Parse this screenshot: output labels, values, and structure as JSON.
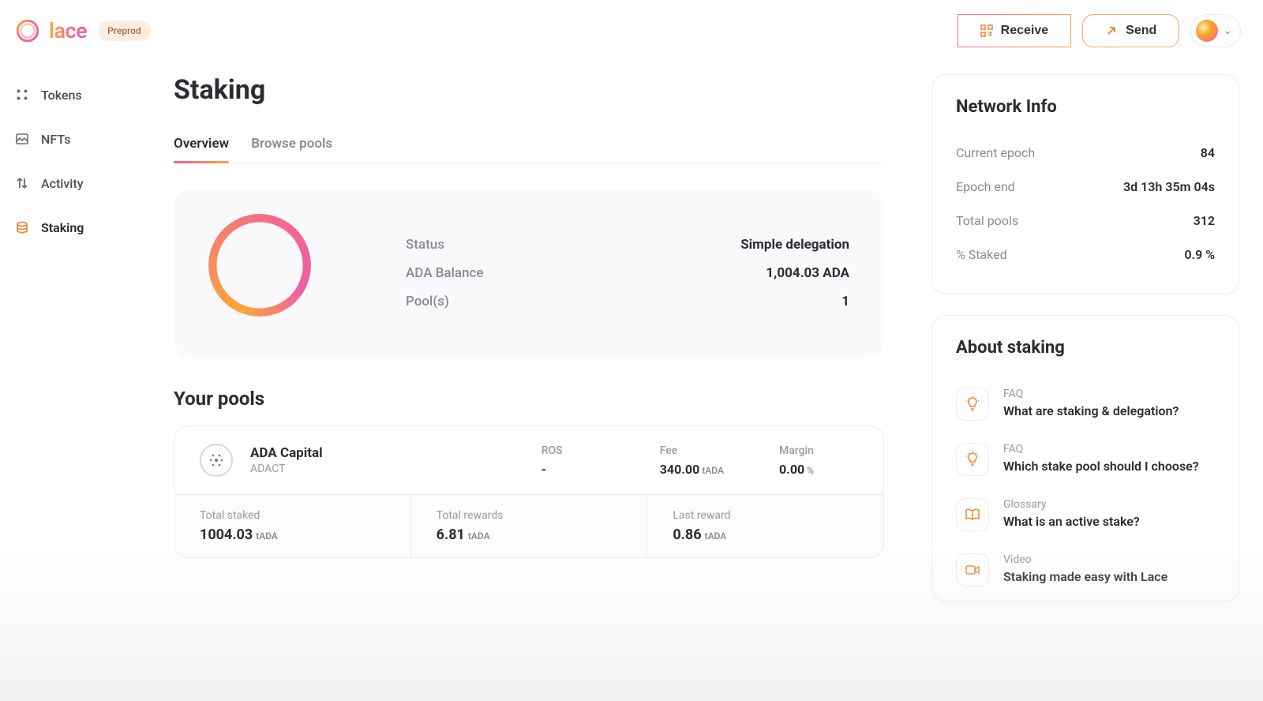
{
  "brand": {
    "name": "lace",
    "env": "Preprod"
  },
  "header": {
    "receive": "Receive",
    "send": "Send"
  },
  "nav": {
    "tokens": "Tokens",
    "nfts": "NFTs",
    "activity": "Activity",
    "staking": "Staking"
  },
  "page": {
    "title": "Staking",
    "tabs": {
      "overview": "Overview",
      "browse": "Browse pools"
    }
  },
  "overview": {
    "status_label": "Status",
    "status_value": "Simple delegation",
    "balance_label": "ADA Balance",
    "balance_value": "1,004.03 ADA",
    "pools_label": "Pool(s)",
    "pools_value": "1"
  },
  "yourpools": {
    "title": "Your pools",
    "pool": {
      "name": "ADA Capital",
      "ticker": "ADACT",
      "ros_label": "ROS",
      "ros_value": "-",
      "fee_label": "Fee",
      "fee_value": "340.00",
      "fee_unit": "tADA",
      "margin_label": "Margin",
      "margin_value": "0.00",
      "margin_unit": "%",
      "total_staked_label": "Total staked",
      "total_staked_value": "1004.03",
      "total_staked_unit": "tADA",
      "total_rewards_label": "Total rewards",
      "total_rewards_value": "6.81",
      "total_rewards_unit": "tADA",
      "last_reward_label": "Last reward",
      "last_reward_value": "0.86",
      "last_reward_unit": "tADA"
    }
  },
  "network": {
    "title": "Network Info",
    "epoch_label": "Current epoch",
    "epoch_value": "84",
    "end_label": "Epoch end",
    "end_value": "3d 13h 35m 04s",
    "pools_label": "Total pools",
    "pools_value": "312",
    "staked_label": "% Staked",
    "staked_value": "0.9 %"
  },
  "about": {
    "title": "About staking",
    "items": [
      {
        "cat": "FAQ",
        "title": "What are staking & delegation?",
        "icon": "lightbulb"
      },
      {
        "cat": "FAQ",
        "title": "Which stake pool should I choose?",
        "icon": "lightbulb"
      },
      {
        "cat": "Glossary",
        "title": "What is an active stake?",
        "icon": "book"
      },
      {
        "cat": "Video",
        "title": "Staking made easy with Lace",
        "icon": "video"
      }
    ]
  }
}
